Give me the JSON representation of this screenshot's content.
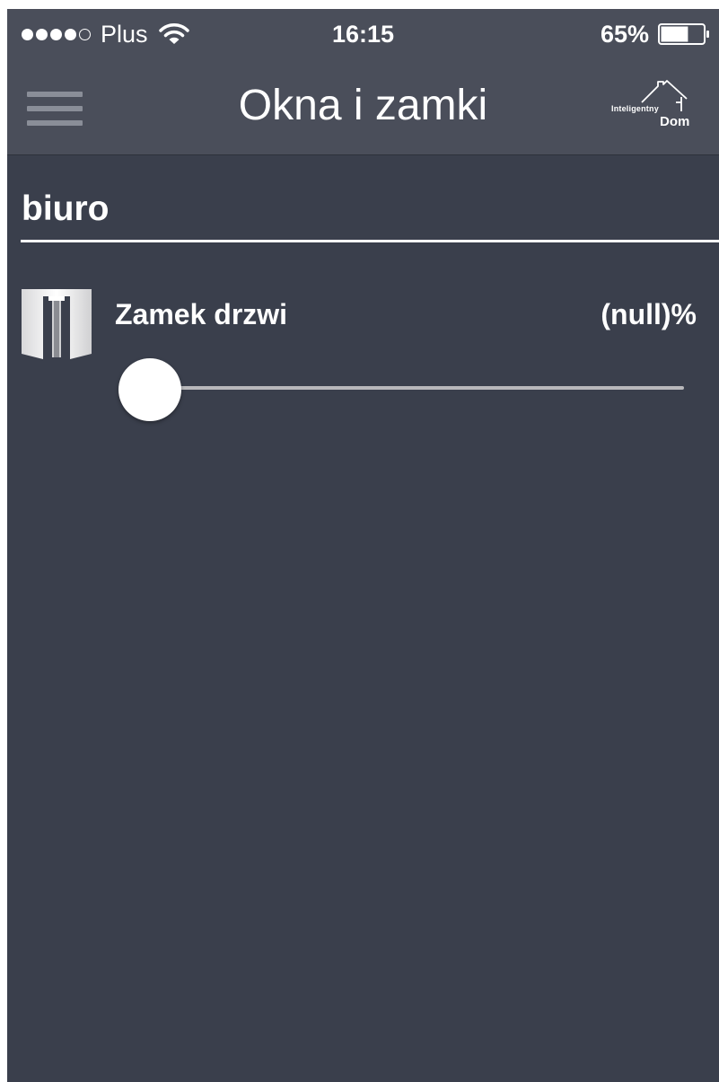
{
  "status_bar": {
    "carrier": "Plus",
    "time": "16:15",
    "battery_percent": "65%",
    "battery_level": 0.65,
    "signal_bars_filled": 4,
    "signal_bars_total": 5,
    "icons": [
      "wifi-icon",
      "battery-icon"
    ]
  },
  "nav": {
    "title": "Okna i zamki",
    "menu_icon": "hamburger-menu-icon",
    "logo": {
      "line1": "Inteligentny",
      "line2": "Dom"
    }
  },
  "section": {
    "title": "biuro"
  },
  "devices": [
    {
      "label": "Zamek drzwi",
      "value": "(null)%",
      "icon": "door-lock-icon",
      "slider_level": 0
    }
  ],
  "colors": {
    "background": "#3a3f4c",
    "bar_background": "#4a4e5a",
    "text": "#ffffff",
    "slider_track": "#b8b8bb"
  }
}
